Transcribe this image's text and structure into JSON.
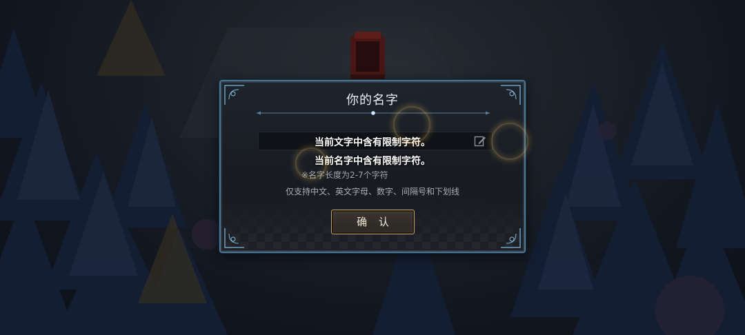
{
  "dialog": {
    "title": "你的名字",
    "input_value": "",
    "error_primary": "当前文字中含有限制字符。",
    "error_secondary": "当前名字中含有限制字符。",
    "hint_length": "※名字长度为2-7个字符",
    "hint_chars": "仅支持中文、英文字母、数字、间隔号和下划线",
    "confirm_label": "确 认"
  },
  "icons": {
    "edit": "edit-pencil-icon"
  },
  "colors": {
    "frame": "#4d7795",
    "button_border": "#c8a26a",
    "sparkle": "#ffc870"
  }
}
